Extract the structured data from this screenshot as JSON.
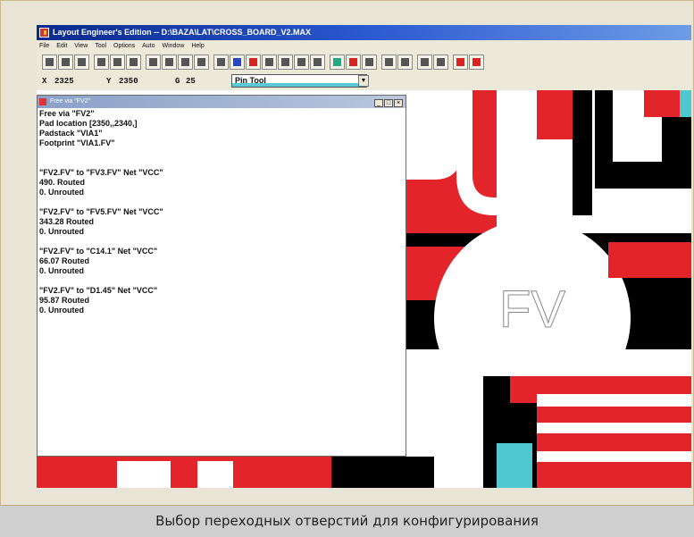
{
  "window": {
    "title": "Layout Engineer's Edition -- D:\\BAZA\\LAT\\CROSS_BOARD_V2.MAX"
  },
  "menu": {
    "items": [
      "File",
      "Edit",
      "View",
      "Tool",
      "Options",
      "Auto",
      "Window",
      "Help"
    ]
  },
  "coords": {
    "x_label": "X",
    "x_value": "2325",
    "y_label": "Y",
    "y_value": "2350",
    "g_label": "G",
    "g_value": "25",
    "tool": "Pin Tool"
  },
  "report": {
    "title": "Free via \"FV2\"",
    "lines": [
      "Free via \"FV2\"",
      "Pad location [2350,,2340,]",
      "Padstack \"VIA1\"",
      "Footprint \"VIA1.FV\"",
      "",
      "",
      "\"FV2.FV\" to \"FV3.FV\" Net \"VCC\"",
      "490. Routed",
      "0. Unrouted",
      "",
      "\"FV2.FV\" to \"FV5.FV\" Net \"VCC\"",
      "343.28 Routed",
      "0. Unrouted",
      "",
      "\"FV2.FV\" to \"C14.1\" Net \"VCC\"",
      "66.07 Routed",
      "0. Unrouted",
      "",
      "\"FV2.FV\" to \"D1.45\" Net \"VCC\"",
      "95.87 Routed",
      "0. Unrouted"
    ],
    "window_buttons": [
      "_",
      "□",
      "×"
    ]
  },
  "board": {
    "label": "FV",
    "colors": {
      "copper": "#e3242b",
      "trace": "#000000",
      "highlight": "#4ec9d2",
      "background": "#ffffff"
    }
  },
  "caption": "Выбор переходных отверстий для конфигурирования"
}
